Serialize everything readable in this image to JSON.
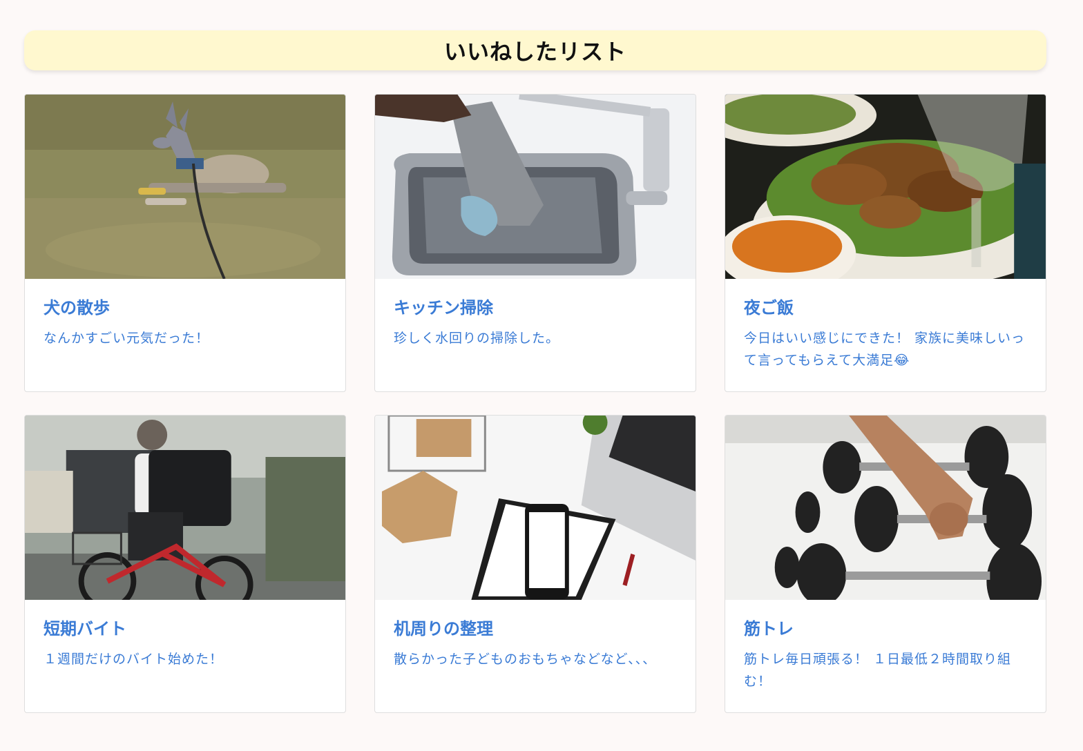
{
  "header": {
    "title": "いいねしたリスト"
  },
  "cards": [
    {
      "title": "犬の散歩",
      "text": "なんかすごい元気だった！",
      "image": "dog-on-grass-photo"
    },
    {
      "title": "キッチン掃除",
      "text": "珍しく水回りの掃除した。",
      "image": "gloved-hand-cleaning-sink-photo"
    },
    {
      "title": "夜ご飯",
      "text": "今日はいい感じにできた！ 家族に美味しいって言ってもらえて大満足😂",
      "image": "dinner-plate-chicken-salad-photo"
    },
    {
      "title": "短期バイト",
      "text": "１週間だけのバイト始めた！",
      "image": "delivery-cyclist-photo"
    },
    {
      "title": "机周りの整理",
      "text": "散らかった子どものおもちゃなどなど､､､",
      "image": "desk-laptop-phone-notebook-photo"
    },
    {
      "title": "筋トレ",
      "text": "筋トレ毎日頑張る！ １日最低２時間取り組む！",
      "image": "dumbbell-rack-photo"
    }
  ],
  "colors": {
    "accent": "#3a7bd5",
    "header_bg": "#fff8cf",
    "page_bg": "#fdf9f8"
  }
}
